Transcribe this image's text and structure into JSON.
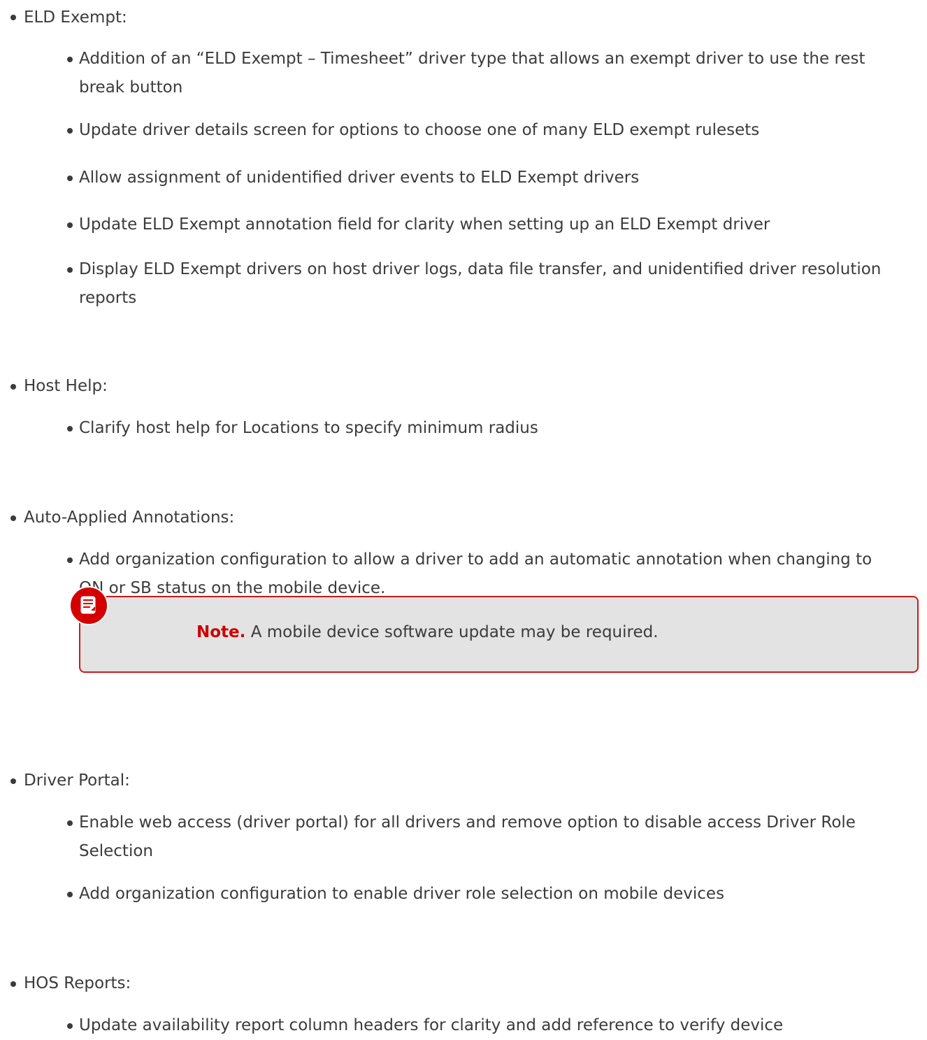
{
  "sections": [
    {
      "title": "ELD Exempt:",
      "items": [
        {
          "lines": [
            "Addition of an “ELD Exempt – Timesheet” driver type that allows an exempt driver to use the rest",
            "break button"
          ]
        },
        {
          "lines": [
            "Update driver details screen for options to choose one of many ELD exempt rulesets"
          ]
        },
        {
          "lines": [
            "Allow assignment of unidentified driver events to ELD Exempt drivers"
          ]
        },
        {
          "lines": [
            "Update ELD Exempt annotation field for clarity when setting up an ELD Exempt driver"
          ]
        },
        {
          "lines": [
            "Display ELD Exempt drivers on host driver logs, data file transfer, and unidentified driver resolution",
            "reports"
          ]
        }
      ]
    },
    {
      "title": "Host Help:",
      "items": [
        {
          "lines": [
            "Clarify host help for Locations to specify minimum radius"
          ]
        }
      ]
    },
    {
      "title": "Auto-Applied Annotations:",
      "items": [
        {
          "lines": [
            "Add organization configuration to allow a driver to add an automatic annotation when changing to",
            "ON or SB status on the mobile device."
          ]
        }
      ],
      "note": {
        "icon": "note-icon",
        "label": "Note.",
        "text": " A mobile device software update may be required."
      }
    },
    {
      "title": "Driver Portal:",
      "items": [
        {
          "lines": [
            "Enable web access (driver portal) for all drivers and remove option to disable access Driver Role",
            "Selection"
          ]
        },
        {
          "lines": [
            "Add organization configuration to enable driver role selection on mobile devices"
          ]
        }
      ]
    },
    {
      "title": "HOS Reports:",
      "items": [
        {
          "lines": [
            "Update availability report column headers for clarity and add reference to verify device"
          ]
        }
      ]
    }
  ],
  "colors": {
    "text": "#3b3b3b",
    "note_border": "#c91a1a",
    "note_background": "#e3e3e3",
    "note_label": "#cc0000",
    "note_icon": "#d40000"
  }
}
